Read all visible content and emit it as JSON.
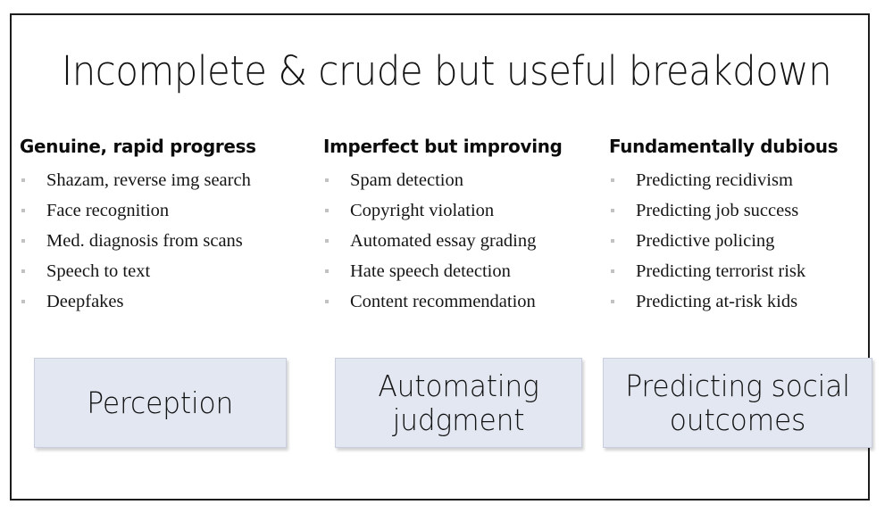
{
  "slide": {
    "title": "Incomplete & crude but useful breakdown",
    "columns": [
      {
        "header": "Genuine, rapid progress",
        "items": [
          "Shazam, reverse img search",
          "Face recognition",
          "Med. diagnosis from scans",
          "Speech to text",
          "Deepfakes"
        ],
        "category_label": "Perception"
      },
      {
        "header": "Imperfect but improving",
        "items": [
          "Spam detection",
          "Copyright violation",
          "Automated essay grading",
          "Hate speech detection",
          "Content recommendation"
        ],
        "category_label": "Automating judgment"
      },
      {
        "header": "Fundamentally dubious",
        "items": [
          "Predicting recidivism",
          "Predicting job success",
          "Predictive policing",
          "Predicting terrorist risk",
          "Predicting at-risk kids"
        ],
        "category_label": "Predicting social outcomes"
      }
    ],
    "colors": {
      "box_fill": "#e2e7f2",
      "box_border": "#c8cede",
      "frame_border": "#1c1c1c",
      "bullet": "#c2c2c2",
      "text": "#131313",
      "background": "#ffffff"
    }
  }
}
